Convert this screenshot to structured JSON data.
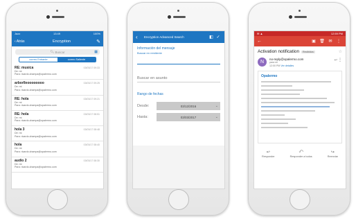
{
  "phone1": {
    "status": {
      "left": "Jazz",
      "time": "13:49",
      "right": "100%"
    },
    "nav": {
      "back": "‹ Atrás",
      "title": "Encryption"
    },
    "search_placeholder": "Buscar",
    "segments": [
      "correo Entrante",
      "correo Saliente"
    ],
    "emails": [
      {
        "subject": "RE: musica",
        "de": "De: mi",
        "para": "Para: ricardo.champa@opalermo.com",
        "date": "03/03/17 09:33"
      },
      {
        "subject": "arborlleoooooooo",
        "de": "De: mi",
        "para": "Para: ricardo.champa@opalermo.com",
        "date": "03/03/17 09:25"
      },
      {
        "subject": "RE: hola",
        "de": "De: mi",
        "para": "Para: ricardo.champa@opalermo.com",
        "date": "03/03/17 09:21"
      },
      {
        "subject": "RE: hola",
        "de": "De: mi",
        "para": "Para: ricardo.champa@opalermo.com",
        "date": "03/03/17 08:51"
      },
      {
        "subject": "hola 3",
        "de": "De: mi",
        "para": "Para: ricardo.champa@opalermo.com",
        "date": "03/03/17 08:48"
      },
      {
        "subject": "hola",
        "de": "De: mi",
        "para": "Para: ricardo.champa@opalermo.com",
        "date": "03/03/17 08:40"
      },
      {
        "subject": "audio 2",
        "de": "De: mi",
        "para": "Para: ricardo.champa@opalermo.com",
        "date": "03/03/17 08:30"
      }
    ],
    "icons": [
      "edit-icon",
      "grid-icon"
    ]
  },
  "phone2": {
    "nav": {
      "back": "‹",
      "title": "Encryption Advanced Search"
    },
    "section_title": "Información del mensaje",
    "section_sub": "Buscar en remitente",
    "asunto_placeholder": "Buscar en asunto",
    "dates_title": "Rango de fechas",
    "desde_label": "Desde:",
    "desde_value": "03/12/2016",
    "hasta_label": "Hasta:",
    "hasta_value": "03/03/2017",
    "accent": "#1e76c2"
  },
  "phone3": {
    "status": {
      "left": "✉ ▲",
      "right": "12:59 PM"
    },
    "subject": "Activation notification",
    "badge": "Recibidos",
    "avatar_letter": "N",
    "from": "no-reply@opalermo.com",
    "to": "para mí",
    "time": "12:00 PM",
    "details_link": "Ver detalles",
    "brand": "Opalermo",
    "actions": [
      "Responder",
      "Responder a todos",
      "Reenviar"
    ],
    "accent": "#db4437"
  }
}
